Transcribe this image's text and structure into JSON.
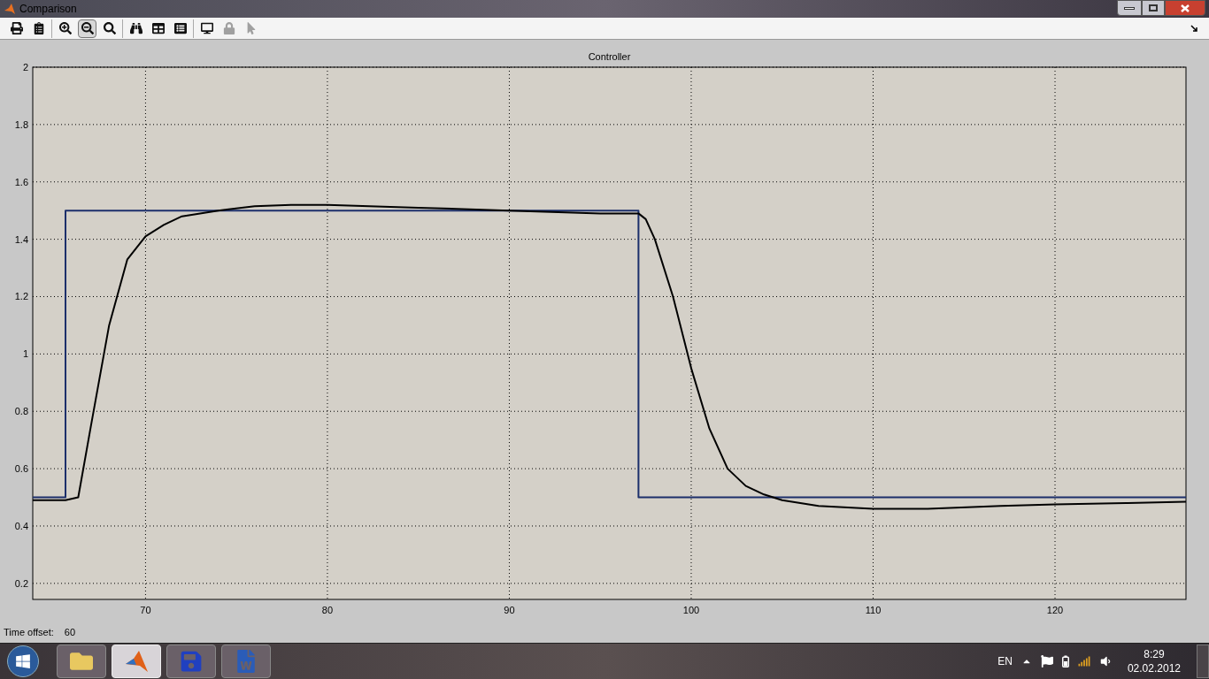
{
  "window": {
    "title": "Comparison"
  },
  "toolbar": {
    "groups": [
      [
        {
          "selected": false,
          "disabled": false
        },
        {
          "selected": false,
          "disabled": false
        }
      ],
      [
        {
          "selected": false,
          "disabled": false
        },
        {
          "selected": true,
          "disabled": false
        },
        {
          "selected": false,
          "disabled": false
        }
      ],
      [
        {
          "selected": false,
          "disabled": false
        },
        {
          "selected": false,
          "disabled": false
        },
        {
          "selected": false,
          "disabled": false
        }
      ],
      [
        {
          "selected": false,
          "disabled": false
        },
        {
          "selected": false,
          "disabled": true
        },
        {
          "selected": false,
          "disabled": true
        }
      ]
    ]
  },
  "chart_data": {
    "type": "line",
    "title": "Controller",
    "grid": true,
    "xlim": [
      63.8,
      127.2
    ],
    "ylim": [
      0.144,
      2
    ],
    "xticks": [
      70,
      80,
      90,
      100,
      110,
      120
    ],
    "yticks": [
      0.2,
      0.4,
      0.6,
      0.8,
      1,
      1.2,
      1.4,
      1.6,
      1.8,
      2
    ],
    "x": [
      63.8,
      65.6,
      65.6,
      66.3,
      67,
      68,
      69,
      70,
      71,
      72,
      74,
      76,
      78,
      80,
      85,
      90,
      95,
      97,
      97.1,
      97.1,
      97.5,
      98,
      99,
      100,
      101,
      102,
      103,
      104,
      105,
      107,
      110,
      113,
      117,
      120,
      124,
      127.2
    ],
    "series": [
      {
        "color": "#1c2f6b",
        "values": [
          0.5,
          0.5,
          1.5,
          1.5,
          1.5,
          1.5,
          1.5,
          1.5,
          1.5,
          1.5,
          1.5,
          1.5,
          1.5,
          1.5,
          1.5,
          1.5,
          1.5,
          1.5,
          1.5,
          0.5,
          0.5,
          0.5,
          0.5,
          0.5,
          0.5,
          0.5,
          0.5,
          0.5,
          0.5,
          0.5,
          0.5,
          0.5,
          0.5,
          0.5,
          0.5,
          0.5
        ]
      },
      {
        "color": "#000000",
        "values": [
          0.49,
          0.49,
          0.49,
          0.5,
          0.75,
          1.1,
          1.33,
          1.41,
          1.45,
          1.48,
          1.5,
          1.515,
          1.52,
          1.52,
          1.51,
          1.5,
          1.49,
          1.49,
          1.49,
          1.49,
          1.47,
          1.4,
          1.2,
          0.95,
          0.74,
          0.6,
          0.54,
          0.51,
          0.49,
          0.47,
          0.46,
          0.46,
          0.47,
          0.475,
          0.48,
          0.485
        ]
      }
    ]
  },
  "status": {
    "label": "Time offset:",
    "value": "60"
  },
  "taskbar": {
    "apps": [
      {
        "active": false
      },
      {
        "active": true
      },
      {
        "active": false
      },
      {
        "active": false
      }
    ],
    "language": "EN",
    "time": "8:29",
    "date": "02.02.2012"
  }
}
